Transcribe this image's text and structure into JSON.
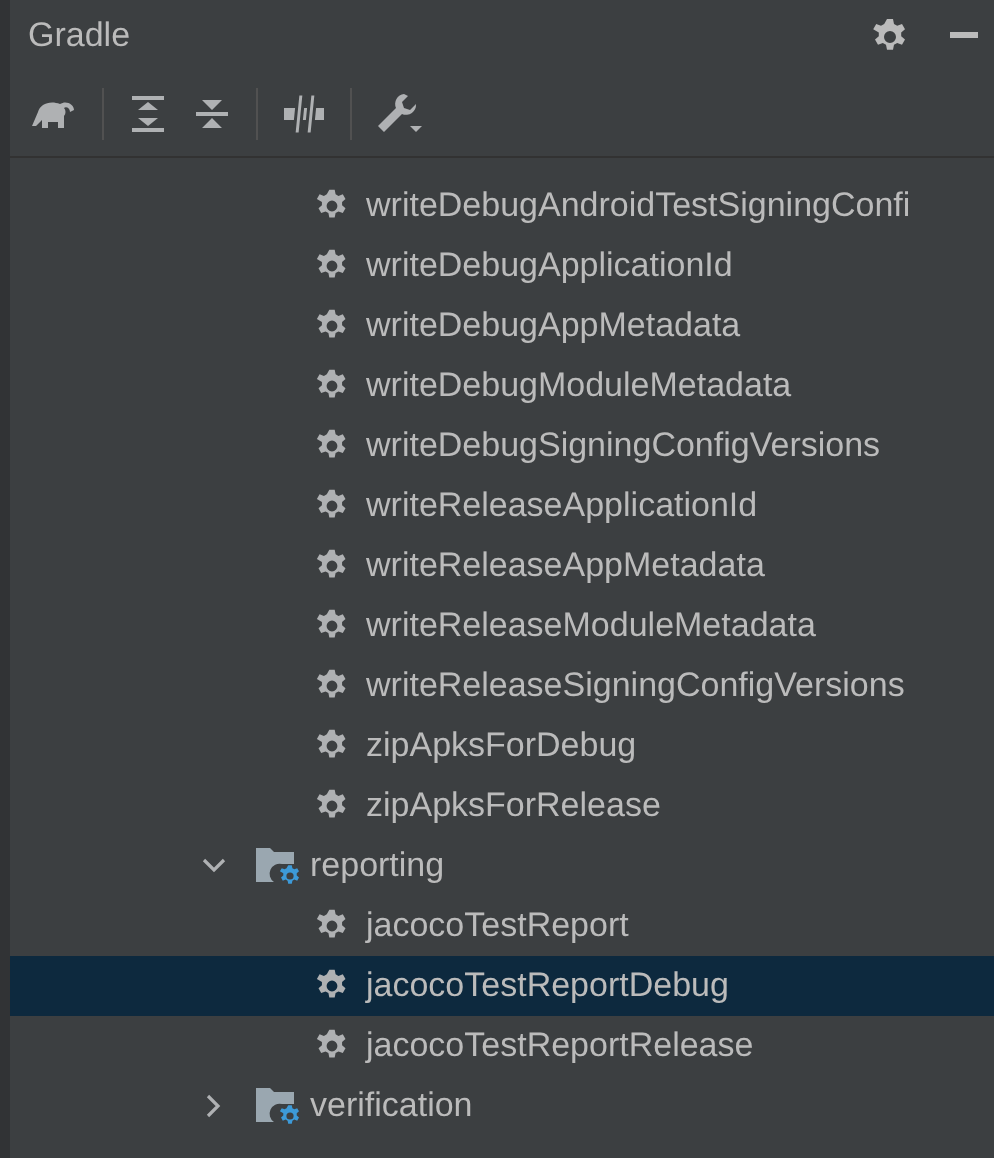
{
  "panel": {
    "title": "Gradle"
  },
  "tree": [
    {
      "kind": "task",
      "label": "writeDebugAndroidTestSigningConfi",
      "selected": false
    },
    {
      "kind": "task",
      "label": "writeDebugApplicationId",
      "selected": false
    },
    {
      "kind": "task",
      "label": "writeDebugAppMetadata",
      "selected": false
    },
    {
      "kind": "task",
      "label": "writeDebugModuleMetadata",
      "selected": false
    },
    {
      "kind": "task",
      "label": "writeDebugSigningConfigVersions",
      "selected": false
    },
    {
      "kind": "task",
      "label": "writeReleaseApplicationId",
      "selected": false
    },
    {
      "kind": "task",
      "label": "writeReleaseAppMetadata",
      "selected": false
    },
    {
      "kind": "task",
      "label": "writeReleaseModuleMetadata",
      "selected": false
    },
    {
      "kind": "task",
      "label": "writeReleaseSigningConfigVersions",
      "selected": false
    },
    {
      "kind": "task",
      "label": "zipApksForDebug",
      "selected": false
    },
    {
      "kind": "task",
      "label": "zipApksForRelease",
      "selected": false
    },
    {
      "kind": "folder",
      "label": "reporting",
      "expanded": true,
      "selected": false,
      "children": [
        {
          "kind": "task",
          "label": "jacocoTestReport",
          "selected": false
        },
        {
          "kind": "task",
          "label": "jacocoTestReportDebug",
          "selected": true
        },
        {
          "kind": "task",
          "label": "jacocoTestReportRelease",
          "selected": false
        }
      ]
    },
    {
      "kind": "folder",
      "label": "verification",
      "expanded": false,
      "selected": false
    }
  ]
}
